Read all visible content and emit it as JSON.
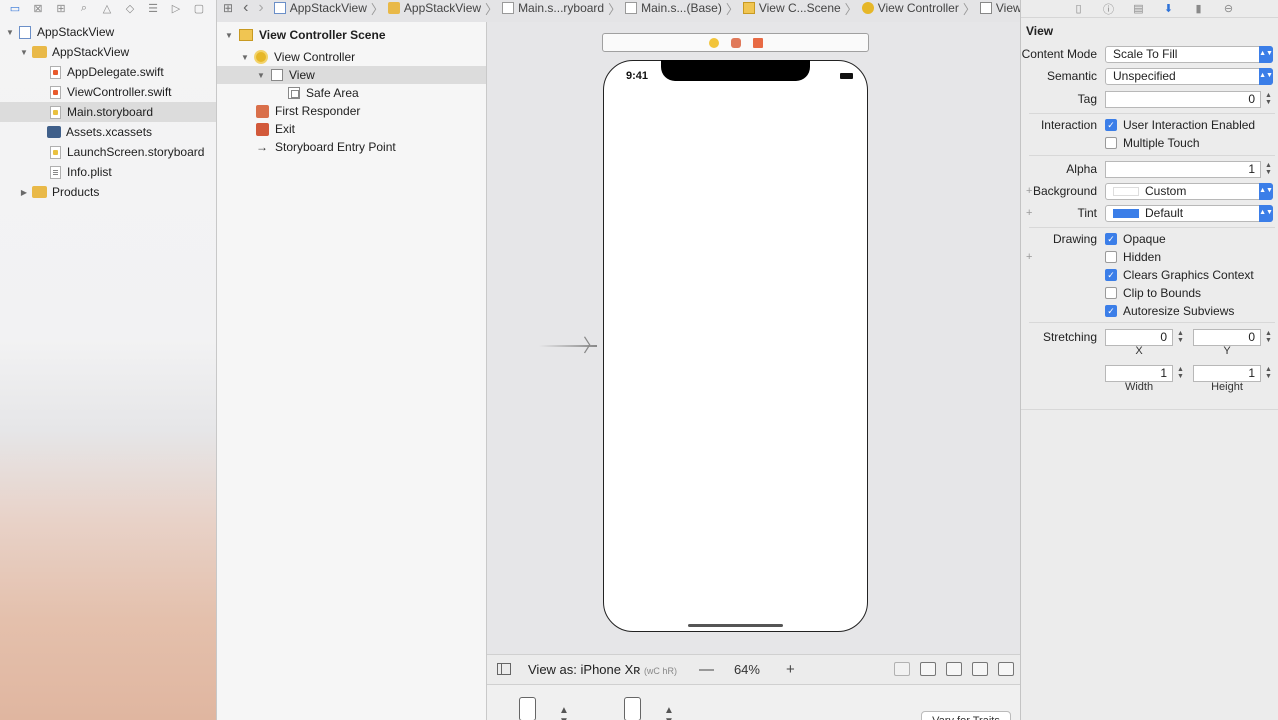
{
  "navigator": {
    "toolbar_icons": [
      "folder-icon",
      "source-control-icon",
      "symbol-icon",
      "find-icon",
      "issue-icon",
      "test-icon",
      "debug-icon",
      "breakpoint-icon",
      "report-icon"
    ],
    "tree": [
      {
        "label": "AppStackView",
        "kind": "project",
        "depth": 0,
        "disclosure": "▼"
      },
      {
        "label": "AppStackView",
        "kind": "folder",
        "depth": 1,
        "disclosure": "▼"
      },
      {
        "label": "AppDelegate.swift",
        "kind": "swift",
        "depth": 2
      },
      {
        "label": "ViewController.swift",
        "kind": "swift",
        "depth": 2
      },
      {
        "label": "Main.storyboard",
        "kind": "storyboard",
        "depth": 2,
        "selected": true
      },
      {
        "label": "Assets.xcassets",
        "kind": "assets",
        "depth": 2
      },
      {
        "label": "LaunchScreen.storyboard",
        "kind": "storyboard",
        "depth": 2
      },
      {
        "label": "Info.plist",
        "kind": "plist",
        "depth": 2
      },
      {
        "label": "Products",
        "kind": "folder",
        "depth": 1,
        "disclosure": "▶"
      }
    ]
  },
  "jumpbar": {
    "back": "‹",
    "forward": "›",
    "items": [
      {
        "label": "AppStackView",
        "icon": "project"
      },
      {
        "label": "AppStackView",
        "icon": "folder"
      },
      {
        "label": "Main.s...ryboard",
        "icon": "storyboard"
      },
      {
        "label": "Main.s...(Base)",
        "icon": "storyboard"
      },
      {
        "label": "View C...Scene",
        "icon": "scene"
      },
      {
        "label": "View Controller",
        "icon": "vc"
      },
      {
        "label": "View",
        "icon": "view"
      }
    ]
  },
  "outline": {
    "items": [
      {
        "label": "View Controller Scene",
        "kind": "scene",
        "indent": 0,
        "disclosure": "▼",
        "bold": true
      },
      {
        "label": "View Controller",
        "kind": "vc",
        "indent": 1,
        "disclosure": "▼"
      },
      {
        "label": "View",
        "kind": "view",
        "indent": 2,
        "disclosure": "▼",
        "selected": true
      },
      {
        "label": "Safe Area",
        "kind": "safe",
        "indent": 3
      },
      {
        "label": "First Responder",
        "kind": "cube",
        "indent": 1
      },
      {
        "label": "Exit",
        "kind": "exit",
        "indent": 1
      },
      {
        "label": "Storyboard Entry Point",
        "kind": "arrow",
        "indent": 1
      }
    ]
  },
  "canvas": {
    "status_time": "9:41"
  },
  "bottombar": {
    "view_as": "View as: iPhone Xʀ",
    "size_class": "(wC hR)",
    "zoom_out": "—",
    "zoom": "64%",
    "zoom_in": "+",
    "vary_button": "Vary for Traits"
  },
  "inspector": {
    "title": "View",
    "content_mode": {
      "label": "Content Mode",
      "value": "Scale To Fill"
    },
    "semantic": {
      "label": "Semantic",
      "value": "Unspecified"
    },
    "tag": {
      "label": "Tag",
      "value": "0"
    },
    "interaction": {
      "label": "Interaction",
      "options": [
        {
          "label": "User Interaction Enabled",
          "checked": true
        },
        {
          "label": "Multiple Touch",
          "checked": false
        }
      ]
    },
    "alpha": {
      "label": "Alpha",
      "value": "1"
    },
    "background": {
      "label": "Background",
      "value": "Custom",
      "swatch": "#ffffff"
    },
    "tint": {
      "label": "Tint",
      "value": "Default",
      "swatch": "#3b7ee8"
    },
    "drawing": {
      "label": "Drawing",
      "options": [
        {
          "label": "Opaque",
          "checked": true
        },
        {
          "label": "Hidden",
          "checked": false
        },
        {
          "label": "Clears Graphics Context",
          "checked": true
        },
        {
          "label": "Clip to Bounds",
          "checked": false
        },
        {
          "label": "Autoresize Subviews",
          "checked": true
        }
      ]
    },
    "stretching": {
      "label": "Stretching",
      "x": "0",
      "y": "0",
      "width": "1",
      "height": "1",
      "x_label": "X",
      "y_label": "Y",
      "width_label": "Width",
      "height_label": "Height"
    }
  }
}
